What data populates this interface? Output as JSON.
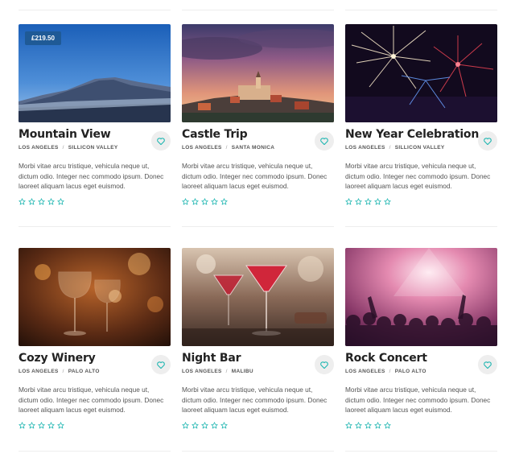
{
  "colors": {
    "accent": "#1bb5b0",
    "price_badge": "#1f5a96",
    "heart_bg": "#eeeeee"
  },
  "cards": [
    {
      "title": "Mountain View",
      "price": "£219.50",
      "location": "LOS ANGELES",
      "sublocation": "SILLICON VALLEY",
      "description": "Morbi vitae arcu tristique, vehicula neque ut, dictum odio. Integer nec commodo ipsum. Donec laoreet aliquam lacus eget euismod.",
      "rating": 0,
      "image": "mountain"
    },
    {
      "title": "Castle Trip",
      "location": "LOS ANGELES",
      "sublocation": "SANTA MONICA",
      "description": "Morbi vitae arcu tristique, vehicula neque ut, dictum odio. Integer nec commodo ipsum. Donec laoreet aliquam lacus eget euismod.",
      "rating": 0,
      "image": "castle"
    },
    {
      "title": "New Year Celebration",
      "location": "LOS ANGELES",
      "sublocation": "SILLICON VALLEY",
      "description": "Morbi vitae arcu tristique, vehicula neque ut, dictum odio. Integer nec commodo ipsum. Donec laoreet aliquam lacus eget euismod.",
      "rating": 0,
      "image": "fireworks"
    },
    {
      "title": "Cozy Winery",
      "location": "LOS ANGELES",
      "sublocation": "PALO ALTO",
      "description": "Morbi vitae arcu tristique, vehicula neque ut, dictum odio. Integer nec commodo ipsum. Donec laoreet aliquam lacus eget euismod.",
      "rating": 0,
      "image": "winery"
    },
    {
      "title": "Night Bar",
      "location": "LOS ANGELES",
      "sublocation": "MALIBU",
      "description": "Morbi vitae arcu tristique, vehicula neque ut, dictum odio. Integer nec commodo ipsum. Donec laoreet aliquam lacus eget euismod.",
      "rating": 0,
      "image": "bar"
    },
    {
      "title": "Rock Concert",
      "location": "LOS ANGELES",
      "sublocation": "PALO ALTO",
      "description": "Morbi vitae arcu tristique, vehicula neque ut, dictum odio. Integer nec commodo ipsum. Donec laoreet aliquam lacus eget euismod.",
      "rating": 0,
      "image": "concert"
    }
  ]
}
